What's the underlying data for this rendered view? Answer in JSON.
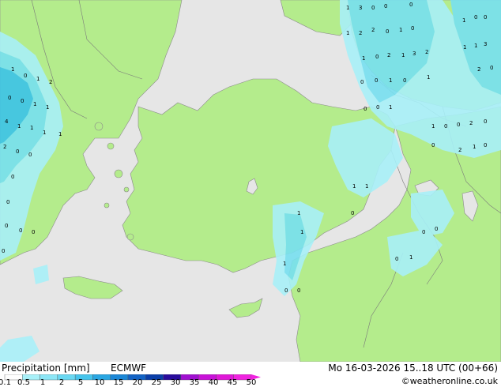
{
  "map": {
    "background_color": "#e6e6e6",
    "land_color": "#b4ec8c",
    "precip_colors": {
      "light": "#a8f0f8",
      "medium": "#78e0f0",
      "heavy": "#3cc4e8"
    },
    "point_values": [
      "1",
      "3",
      "0",
      "0",
      "0",
      "1",
      "0",
      "0",
      "1",
      "2",
      "2",
      "0",
      "1",
      "0",
      "1",
      "0",
      "2",
      "1",
      "3",
      "2",
      "1",
      "1",
      "3",
      "2",
      "0",
      "0",
      "0",
      "1",
      "0",
      "1",
      "0",
      "0",
      "1",
      "1",
      "0",
      "0",
      "2",
      "0",
      "2",
      "1",
      "0",
      "0",
      "1",
      "0",
      "1",
      "2",
      "0",
      "0",
      "1",
      "1",
      "4",
      "1",
      "1",
      "1",
      "1",
      "2",
      "0",
      "0",
      "0",
      "0",
      "0",
      "0",
      "0",
      "0",
      "1",
      "0",
      "1",
      "1",
      "1",
      "1",
      "0",
      "0",
      "0",
      "0",
      "0",
      "1"
    ]
  },
  "footer": {
    "title": "Precipitation [mm]",
    "model": "ECMWF",
    "datetime": "Mo 16-03-2026 15..18 UTC (00+66)",
    "credit": "©weatheronline.co.uk"
  },
  "legend": {
    "ticks": [
      "0.1",
      "0.5",
      "1",
      "2",
      "5",
      "10",
      "15",
      "20",
      "25",
      "30",
      "35",
      "40",
      "45",
      "50"
    ],
    "colors": [
      "#fefefe",
      "#a8f0f8",
      "#8ce6f6",
      "#6ad8f2",
      "#46c4ec",
      "#2aa6e2",
      "#1a86d6",
      "#1262c4",
      "#0a3ea8",
      "#2a0c9c",
      "#a010d0",
      "#c812d8",
      "#e018d8",
      "#f024e0"
    ]
  }
}
